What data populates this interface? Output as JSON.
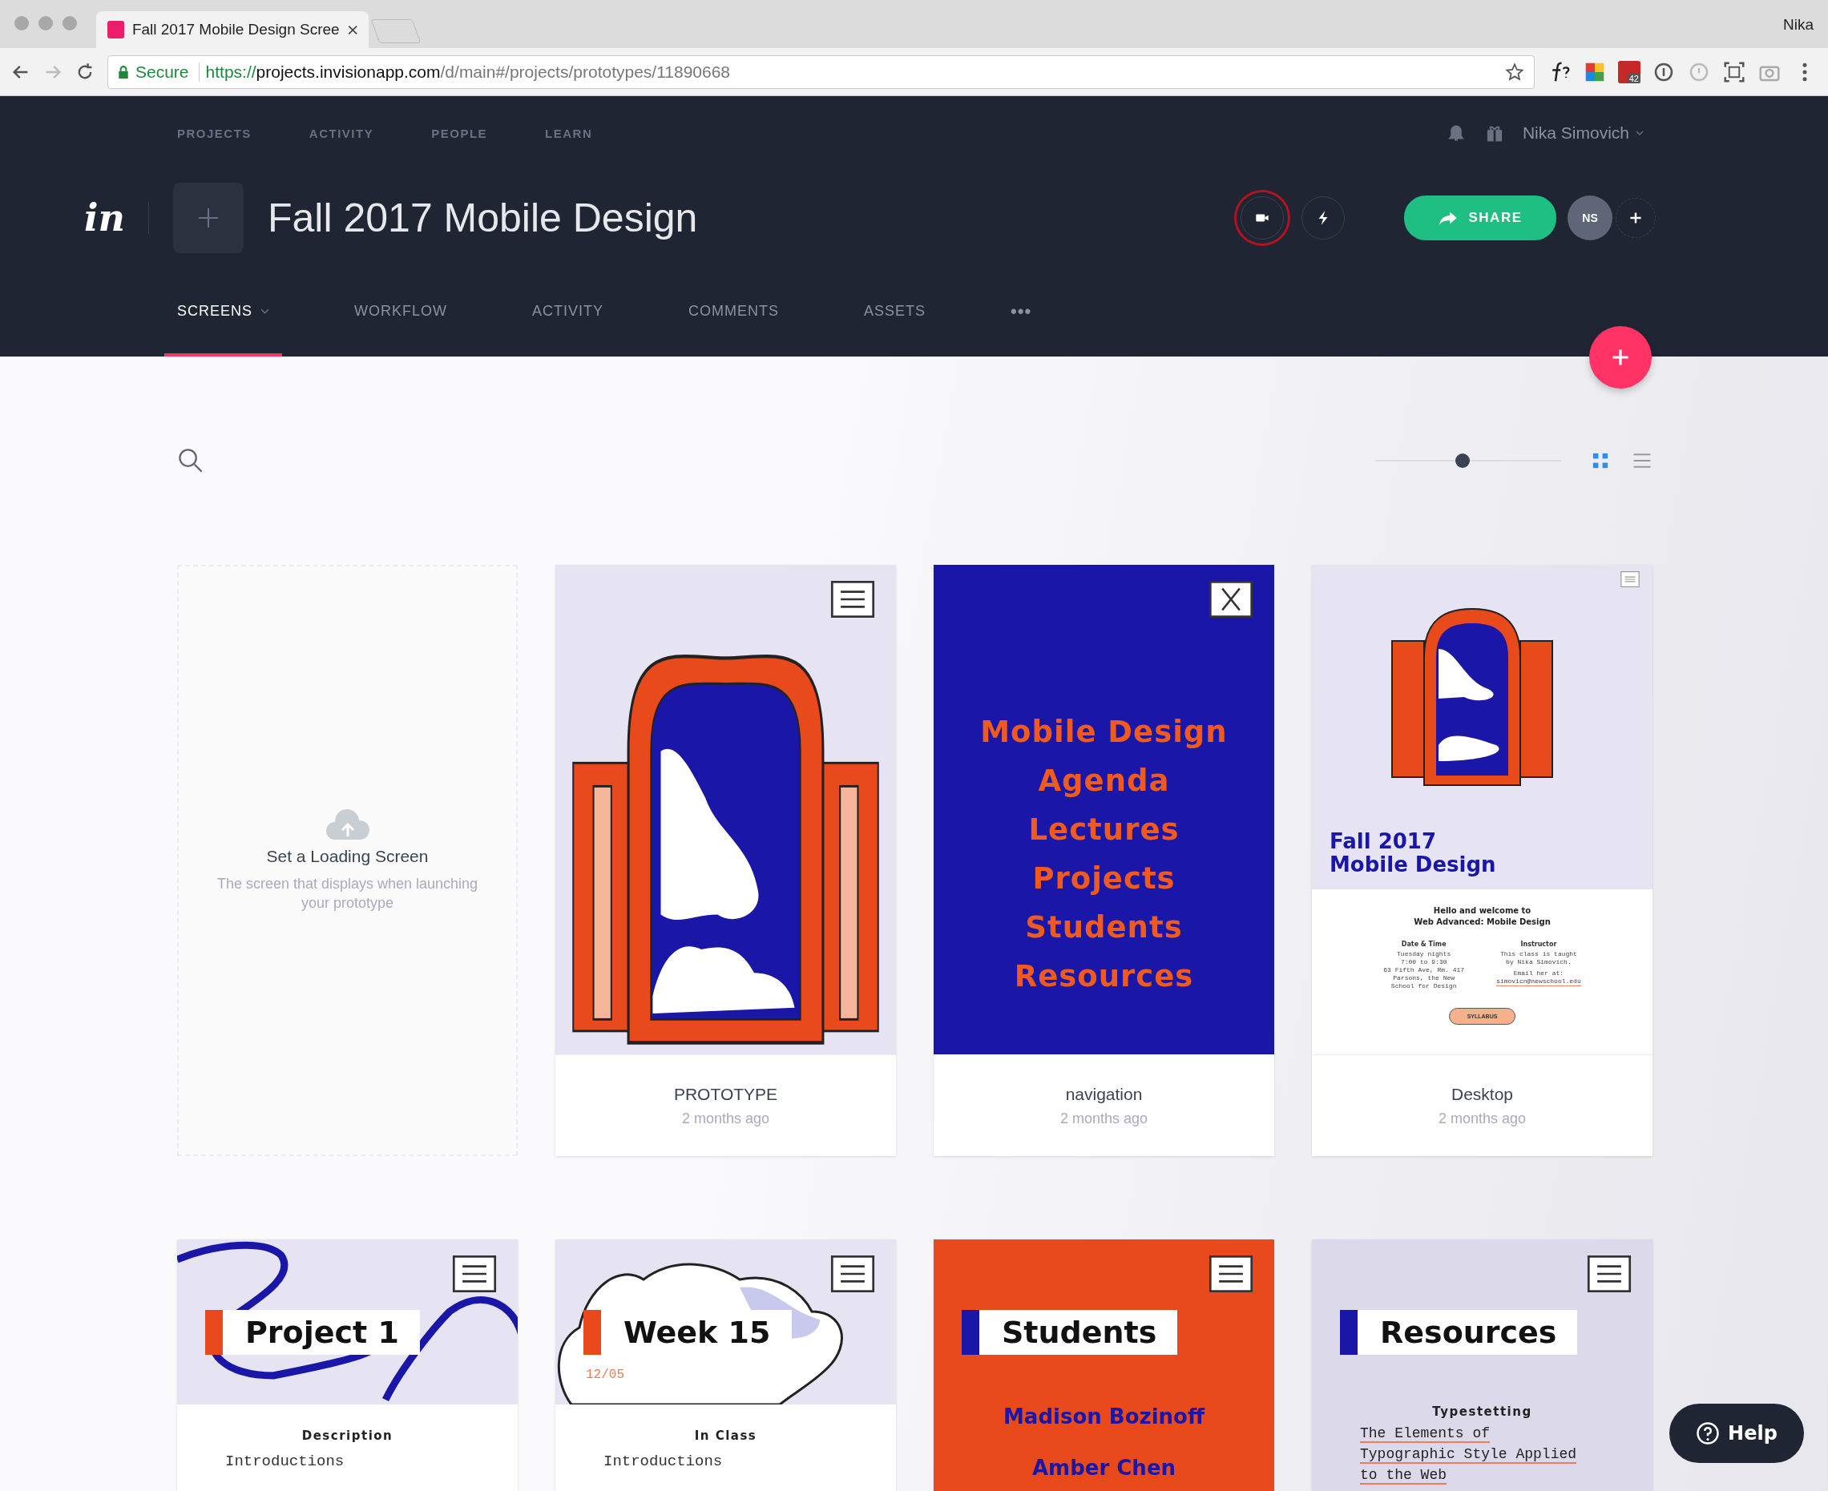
{
  "browser": {
    "tab_title": "Fall 2017 Mobile Design Scree",
    "profile": "Nika",
    "secure_label": "Secure",
    "url_scheme": "https://",
    "url_host": "projects.invisionapp.com",
    "url_path": "/d/main#/projects/prototypes/11890668",
    "ext_badge": "42"
  },
  "top_nav": {
    "items": [
      "PROJECTS",
      "ACTIVITY",
      "PEOPLE",
      "LEARN"
    ],
    "user": "Nika Simovich"
  },
  "project": {
    "logo": "in",
    "title": "Fall 2017 Mobile Design",
    "share": "SHARE",
    "avatar": "NS"
  },
  "tabs": [
    {
      "label": "SCREENS",
      "selected": true,
      "dropdown": true
    },
    {
      "label": "WORKFLOW",
      "selected": false,
      "dropdown": false
    },
    {
      "label": "ACTIVITY",
      "selected": false,
      "dropdown": false
    },
    {
      "label": "COMMENTS",
      "selected": false,
      "dropdown": false
    },
    {
      "label": "ASSETS",
      "selected": false,
      "dropdown": false
    }
  ],
  "more": "•••",
  "toolbar": {
    "zoom": {
      "level": 0.47
    },
    "views": [
      {
        "kind": "grid",
        "selected": true
      },
      {
        "kind": "list",
        "selected": false
      }
    ]
  },
  "loading_card": {
    "title": "Set a Loading Screen",
    "description": "The screen that displays when launching your prototype"
  },
  "screens": [
    {
      "kind": "window",
      "name": "PROTOTYPE",
      "time": "2 months ago"
    },
    {
      "kind": "menu",
      "name": "navigation",
      "time": "2 months ago",
      "items": [
        "Mobile Design",
        "Agenda",
        "Lectures",
        "Projects",
        "Students",
        "Resources"
      ]
    },
    {
      "kind": "desktop",
      "name": "Desktop",
      "time": "2 months ago",
      "heading": [
        "Fall 2017",
        "Mobile Design"
      ],
      "welcome": [
        "Hello and welcome to",
        "Web Advanced: Mobile Design"
      ],
      "col1_title": "Date & Time",
      "col1_lines": [
        "Tuesday nights",
        "7:00 to 9:30",
        "63 Fifth Ave, Rm. 417",
        "Parsons, the New",
        "School for Design"
      ],
      "col2_title": "Instructor",
      "col2_lines": [
        "This class is taught",
        "by Nika Simovich."
      ],
      "col2_email_label": "Email her at:",
      "col2_email": "simovicn@newschool.edu",
      "button": "SYLLABUS"
    },
    {
      "kind": "project",
      "title": "Project 1",
      "color": "#e84a1c",
      "subtitle": "Description",
      "lines": [
        "Introductions"
      ]
    },
    {
      "kind": "week",
      "title": "Week 15",
      "color": "#e84a1c",
      "date": "12/05",
      "subtitle": "In Class",
      "lines": [
        "Introductions"
      ]
    },
    {
      "kind": "students",
      "title": "Students",
      "color": "#1a17a8",
      "lines": [
        "Madison Bozinoff",
        "Amber Chen"
      ]
    },
    {
      "kind": "resources",
      "title": "Resources",
      "color": "#1a17a8",
      "subtitle": "Typestetting",
      "links": [
        "The Elements of",
        "Typographic Style Applied",
        "to the Web"
      ]
    }
  ],
  "help": "Help"
}
